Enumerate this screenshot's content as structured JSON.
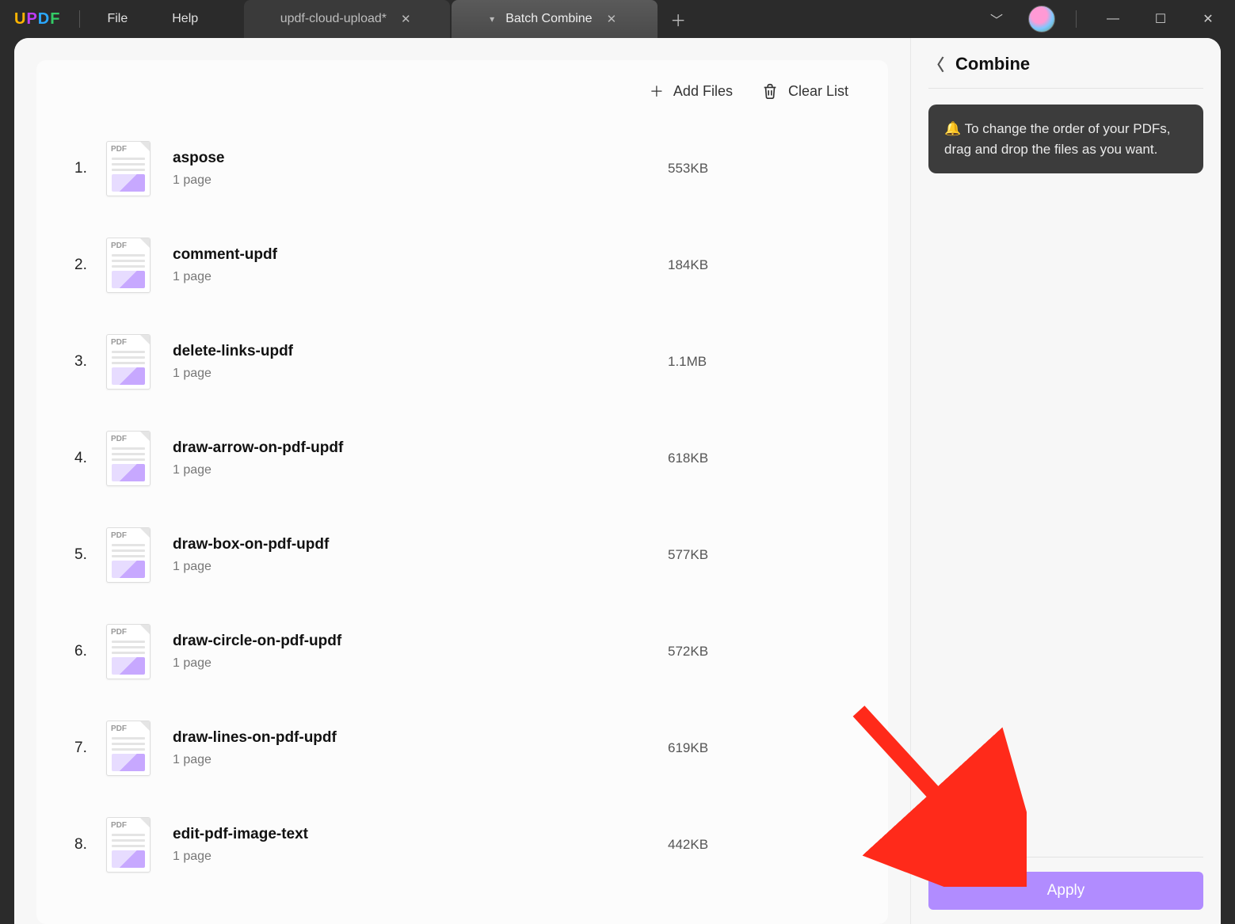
{
  "titlebar": {
    "logo_letters": [
      "U",
      "P",
      "D",
      "F"
    ],
    "menus": {
      "file": "File",
      "help": "Help"
    },
    "tabs": [
      {
        "label": "updf-cloud-upload*",
        "active": false
      },
      {
        "label": "Batch Combine",
        "active": true
      }
    ]
  },
  "toolbar": {
    "add_files": "Add Files",
    "clear_list": "Clear List"
  },
  "files": [
    {
      "index": "1.",
      "name": "aspose",
      "pages": "1 page",
      "size": "553KB"
    },
    {
      "index": "2.",
      "name": "comment-updf",
      "pages": "1 page",
      "size": "184KB"
    },
    {
      "index": "3.",
      "name": "delete-links-updf",
      "pages": "1 page",
      "size": "1.1MB"
    },
    {
      "index": "4.",
      "name": "draw-arrow-on-pdf-updf",
      "pages": "1 page",
      "size": "618KB"
    },
    {
      "index": "5.",
      "name": "draw-box-on-pdf-updf",
      "pages": "1 page",
      "size": "577KB"
    },
    {
      "index": "6.",
      "name": "draw-circle-on-pdf-updf",
      "pages": "1 page",
      "size": "572KB"
    },
    {
      "index": "7.",
      "name": "draw-lines-on-pdf-updf",
      "pages": "1 page",
      "size": "619KB"
    },
    {
      "index": "8.",
      "name": "edit-pdf-image-text",
      "pages": "1 page",
      "size": "442KB"
    }
  ],
  "side": {
    "title": "Combine",
    "tip_icon": "🔔",
    "tip_text": "To change the order of your PDFs, drag and drop the files as you want.",
    "apply": "Apply"
  }
}
